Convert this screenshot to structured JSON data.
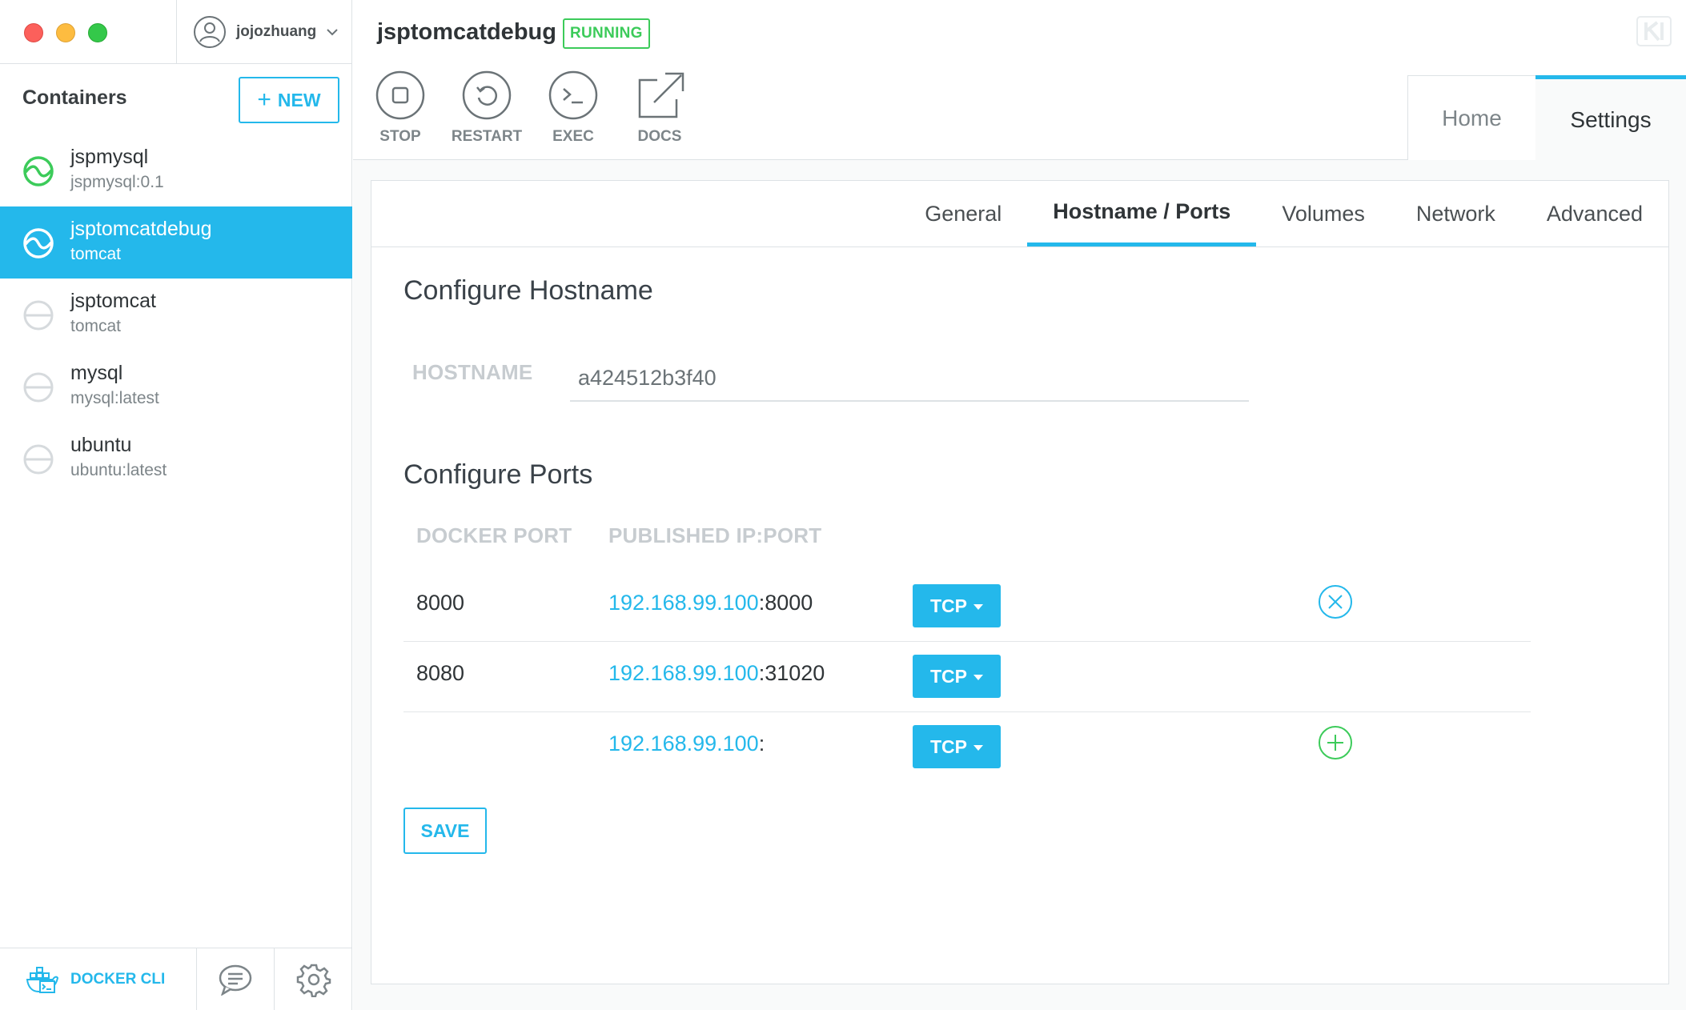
{
  "user": {
    "name": "jojozhuang"
  },
  "sidebar": {
    "title": "Containers",
    "new_label": "NEW",
    "containers": [
      {
        "name": "jspmysql",
        "image": "jspmysql:0.1",
        "state": "running"
      },
      {
        "name": "jsptomcatdebug",
        "image": "tomcat",
        "state": "selected"
      },
      {
        "name": "jsptomcat",
        "image": "tomcat",
        "state": "stopped"
      },
      {
        "name": "mysql",
        "image": "mysql:latest",
        "state": "stopped"
      },
      {
        "name": "ubuntu",
        "image": "ubuntu:latest",
        "state": "stopped"
      }
    ],
    "bottom": {
      "docker_cli_label": "DOCKER CLI"
    }
  },
  "header": {
    "container_name": "jsptomcatdebug",
    "status": "RUNNING",
    "actions": [
      {
        "label": "STOP",
        "icon": "stop-icon"
      },
      {
        "label": "RESTART",
        "icon": "restart-icon"
      },
      {
        "label": "EXEC",
        "icon": "terminal-icon"
      },
      {
        "label": "DOCS",
        "icon": "external-link-icon"
      }
    ],
    "tabs": [
      {
        "label": "Home",
        "active": false
      },
      {
        "label": "Settings",
        "active": true
      }
    ]
  },
  "settings": {
    "subtabs": [
      {
        "label": "General",
        "active": false
      },
      {
        "label": "Hostname / Ports",
        "active": true
      },
      {
        "label": "Volumes",
        "active": false
      },
      {
        "label": "Network",
        "active": false
      },
      {
        "label": "Advanced",
        "active": false
      }
    ],
    "hostname_section_title": "Configure Hostname",
    "hostname_label": "HOSTNAME",
    "hostname_value": "a424512b3f40",
    "ports_section_title": "Configure Ports",
    "ports_headers": {
      "docker_port": "DOCKER PORT",
      "published": "PUBLISHED IP:PORT"
    },
    "ports": [
      {
        "docker_port": "8000",
        "ip": "192.168.99.100",
        "host_port": ":8000",
        "protocol": "TCP",
        "action": "remove"
      },
      {
        "docker_port": "8080",
        "ip": "192.168.99.100",
        "host_port": ":31020",
        "protocol": "TCP",
        "action": "none"
      },
      {
        "docker_port": "",
        "ip": "192.168.99.100",
        "host_port": ":",
        "protocol": "TCP",
        "action": "add"
      }
    ],
    "save_label": "SAVE"
  },
  "colors": {
    "accent": "#24b8eb",
    "running": "#3ccb5a",
    "remove": "#24b8eb",
    "add": "#3ccb5a"
  }
}
